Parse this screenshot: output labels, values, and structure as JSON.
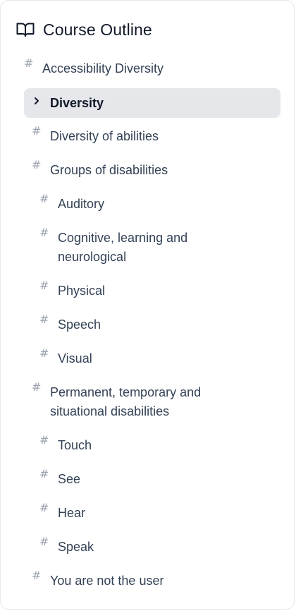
{
  "header": {
    "icon": "book-open-icon",
    "title": "Course Outline"
  },
  "outline": {
    "items": [
      {
        "label": "Accessibility Diversity",
        "level": 0
      },
      {
        "label": "Diversity",
        "level": 1,
        "active": true
      },
      {
        "label": "Diversity of abilities",
        "level": 1
      },
      {
        "label": "Groups of disabilities",
        "level": 1
      },
      {
        "label": "Auditory",
        "level": 2
      },
      {
        "label": "Cognitive, learning and neurological",
        "level": 2
      },
      {
        "label": "Physical",
        "level": 2
      },
      {
        "label": "Speech",
        "level": 2
      },
      {
        "label": "Visual",
        "level": 2
      },
      {
        "label": "Permanent, temporary and situational disabilities",
        "level": 1
      },
      {
        "label": "Touch",
        "level": 2
      },
      {
        "label": "See",
        "level": 2
      },
      {
        "label": "Hear",
        "level": 2
      },
      {
        "label": "Speak",
        "level": 2
      },
      {
        "label": "You are not the user",
        "level": 1
      }
    ]
  }
}
